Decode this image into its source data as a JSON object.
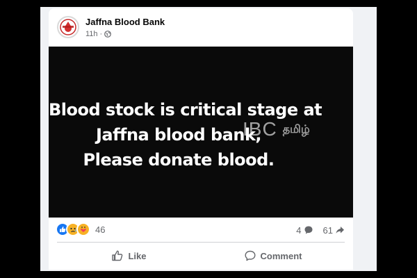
{
  "post": {
    "page_name": "Jaffna Blood Bank",
    "time": "11h",
    "privacy_icon": "globe-icon",
    "avatar_icon": "blood-drop-logo"
  },
  "image": {
    "lines": [
      "Blood stock is critical stage at",
      "Jaffna blood bank,",
      "Please donate blood."
    ],
    "watermark_ibc": "IBC",
    "watermark_tamil": "தமிழ்"
  },
  "engagement": {
    "reaction_icons": [
      "like-reaction-icon",
      "sad-reaction-icon",
      "care-reaction-icon"
    ],
    "reaction_count": "46",
    "comment_count": "4",
    "share_count": "61"
  },
  "actions": {
    "like_label": "Like",
    "comment_label": "Comment"
  },
  "colors": {
    "like_blue": "#1877f2",
    "reaction_yellow": "#f7b125",
    "text_secondary": "#65676b"
  }
}
